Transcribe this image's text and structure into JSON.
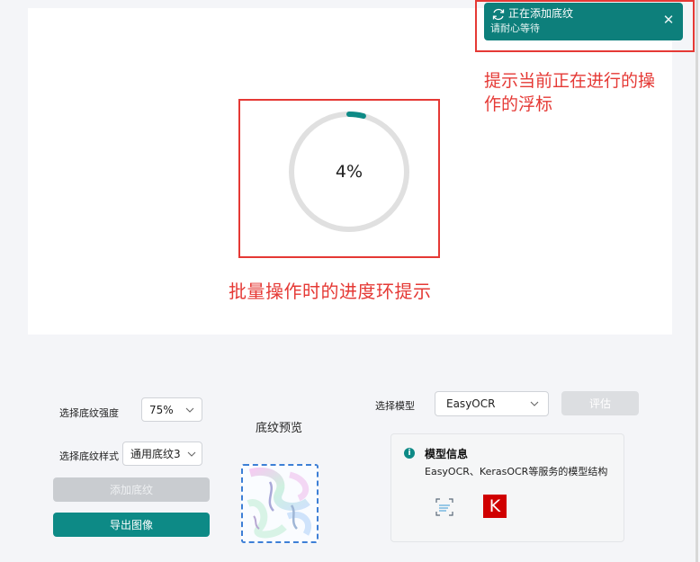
{
  "toast": {
    "title": "正在添加底纹",
    "message": "请耐心等待",
    "close_glyph": "✕",
    "icon": "refresh-icon"
  },
  "annotations": {
    "toast_caption": "提示当前正在进行的操作的浮标",
    "progress_caption": "批量操作时的进度环提示"
  },
  "progress": {
    "value": 0.04,
    "label": "4%"
  },
  "controls": {
    "strength_label": "选择底纹强度",
    "strength_value": "75%",
    "style_label": "选择底纹样式",
    "style_value": "通用底纹3",
    "add_button": "添加底纹",
    "export_button": "导出图像",
    "preview_title": "底纹预览",
    "model_label": "选择模型",
    "model_value": "EasyOCR",
    "evaluate_button": "评估"
  },
  "model_info": {
    "title": "模型信息",
    "description": "EasyOCR、KerasOCR等服务的模型结构",
    "logos": [
      "easyocr-logo",
      "keras-logo"
    ],
    "keras_letter": "K"
  },
  "colors": {
    "accent": "#0d8a86",
    "toast_bg": "#0d7f7b",
    "annotation_red": "#e53935",
    "progress_track": "#e0e0e0"
  }
}
